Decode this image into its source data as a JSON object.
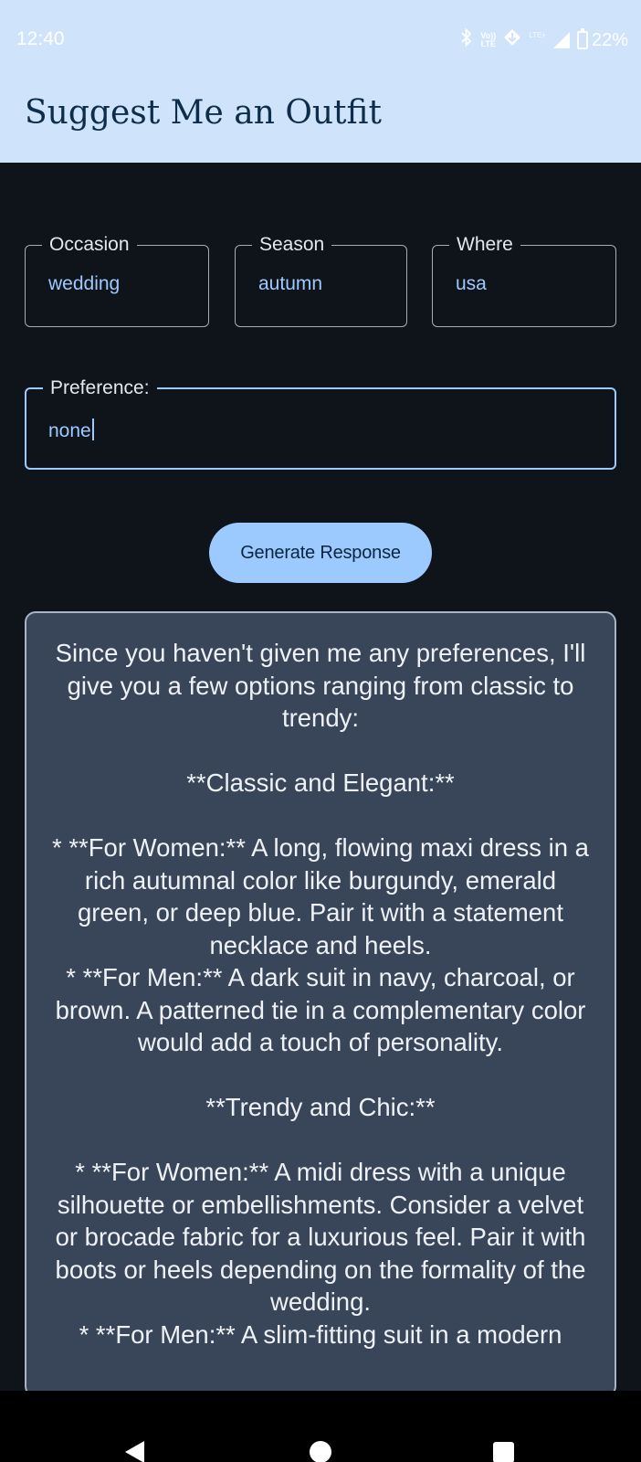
{
  "status_bar": {
    "time": "12:40",
    "icons": [
      "bluetooth-icon",
      "volte-icon",
      "data-saver-icon",
      "signal-icon",
      "battery-icon"
    ],
    "volte_top": "Vo))",
    "volte_bottom": "LTE",
    "lte_label": "LTE+",
    "battery_percent": "22%"
  },
  "app": {
    "title": "Suggest Me an Outfit",
    "header_color": "#cfe3fb",
    "accent_color": "#9ccaff"
  },
  "form": {
    "occasion": {
      "label": "Occasion",
      "value": "wedding"
    },
    "season": {
      "label": "Season",
      "value": "autumn"
    },
    "where": {
      "label": "Where",
      "value": "usa"
    },
    "preference": {
      "label": "Preference:",
      "value": "none"
    }
  },
  "actions": {
    "generate_label": "Generate Response"
  },
  "response": {
    "paragraphs": [
      "Since you haven't given me any preferences, I'll give you a few options ranging from classic to trendy:",
      "",
      "**Classic and Elegant:**",
      "",
      "* **For Women:** A long, flowing maxi dress in a rich autumnal color like burgundy, emerald green, or deep blue. Pair it with a statement necklace and heels.",
      "* **For Men:** A dark suit in navy, charcoal, or brown. A patterned tie in a complementary color would add a touch of personality.",
      "",
      "**Trendy and Chic:**",
      "",
      "* **For Women:** A midi dress with a unique silhouette or embellishments. Consider a velvet or brocade fabric for a luxurious feel. Pair it with boots or heels depending on the formality of the wedding.",
      "* **For Men:** A slim-fitting suit in a modern"
    ]
  },
  "nav_bar": {
    "icons": [
      "back-icon",
      "home-icon",
      "recents-icon"
    ]
  }
}
